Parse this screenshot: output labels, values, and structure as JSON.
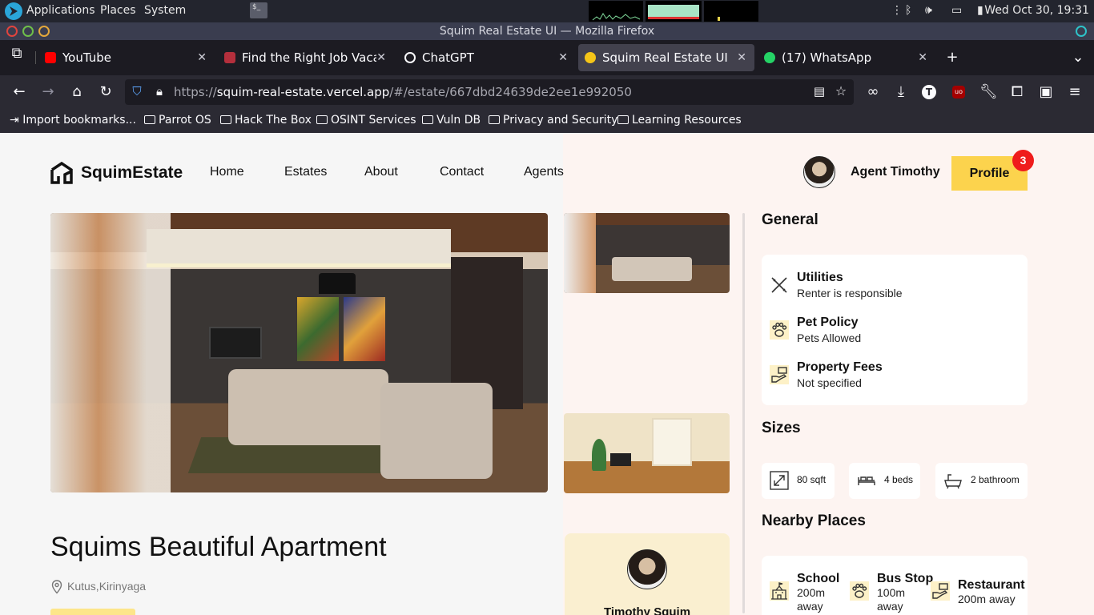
{
  "os": {
    "menus": [
      "Applications",
      "Places",
      "System"
    ],
    "clock": "Wed Oct 30, 19:31"
  },
  "window": {
    "title": "Squim Real Estate UI — Mozilla Firefox"
  },
  "tabs": [
    {
      "label": "YouTube",
      "color": "#ff0000"
    },
    {
      "label": "Find the Right Job Vacanc",
      "color": "#b42f3c"
    },
    {
      "label": "ChatGPT",
      "color": "#ffffff"
    },
    {
      "label": "Squim Real Estate UI",
      "color": "#f5c518"
    },
    {
      "label": "(17) WhatsApp",
      "color": "#25d366"
    }
  ],
  "urlbar": {
    "prefix": "https://",
    "host": "squim-real-estate.vercel.app",
    "path": "/#/estate/667dbd24639de2ee1e992050"
  },
  "bookmarks": [
    "Import bookmarks...",
    "Parrot OS",
    "Hack The Box",
    "OSINT Services",
    "Vuln DB",
    "Privacy and Security",
    "Learning Resources"
  ],
  "site": {
    "brand": "SquimEstate",
    "nav": [
      "Home",
      "Estates",
      "About",
      "Contact",
      "Agents"
    ],
    "agent_name": "Agent Timothy",
    "profile_label": "Profile",
    "profile_badge": "3",
    "accent": "#fcd34d"
  },
  "estate": {
    "title": "Squims Beautiful Apartment",
    "location": "Kutus,Kirinyaga",
    "agent_card_name": "Timothy Squim"
  },
  "general": {
    "heading": "General",
    "items": [
      {
        "title": "Utilities",
        "subtitle": "Renter is responsible",
        "icon": "tools-icon"
      },
      {
        "title": "Pet Policy",
        "subtitle": "Pets Allowed",
        "icon": "paw-icon"
      },
      {
        "title": "Property Fees",
        "subtitle": "Not specified",
        "icon": "fees-icon"
      }
    ]
  },
  "sizes": {
    "heading": "Sizes",
    "items": [
      {
        "label": "80 sqft",
        "icon": "expand-icon"
      },
      {
        "label": "4 beds",
        "icon": "bed-icon"
      },
      {
        "label": "2 bathroom",
        "icon": "bath-icon"
      }
    ]
  },
  "nearby": {
    "heading": "Nearby Places",
    "items": [
      {
        "title": "School",
        "subtitle": "200m away",
        "icon": "school-icon"
      },
      {
        "title": "Bus Stop",
        "subtitle": "100m away",
        "icon": "bus-icon"
      },
      {
        "title": "Restaurant",
        "subtitle": "200m away",
        "icon": "restaurant-icon"
      }
    ]
  }
}
